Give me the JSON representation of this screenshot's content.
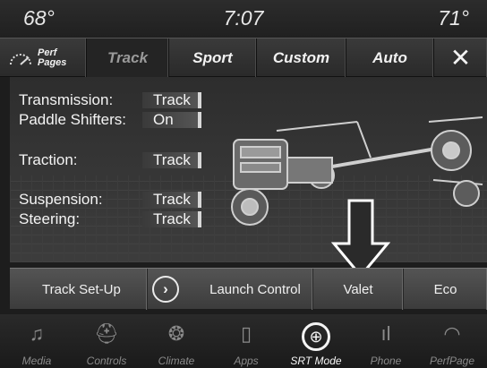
{
  "statusbar": {
    "temp_left": "68°",
    "clock": "7:07",
    "temp_right": "71°"
  },
  "tabs": {
    "perf_line1": "Perf",
    "perf_line2": "Pages",
    "track": "Track",
    "sport": "Sport",
    "custom": "Custom",
    "auto": "Auto",
    "close": "✕"
  },
  "settings": [
    {
      "label": "Transmission:",
      "value": "Track"
    },
    {
      "label": "Paddle Shifters:",
      "value": "On"
    },
    {
      "label": "Traction:",
      "value": "Track"
    },
    {
      "label": "Suspension:",
      "value": "Track"
    },
    {
      "label": "Steering:",
      "value": "Track"
    }
  ],
  "actions": {
    "setup": "Track Set-Up",
    "chevron": "›",
    "launch": "Launch Control",
    "valet": "Valet",
    "eco": "Eco"
  },
  "dock": [
    {
      "label": "Media",
      "icon": "music-note-icon",
      "glyph": "♫"
    },
    {
      "label": "Controls",
      "icon": "seat-icon",
      "glyph": "⛑"
    },
    {
      "label": "Climate",
      "icon": "climate-icon",
      "glyph": "❂"
    },
    {
      "label": "Apps",
      "icon": "apps-icon",
      "glyph": "▯"
    },
    {
      "label": "SRT Mode",
      "icon": "steering-wheel-icon",
      "glyph": "⊕"
    },
    {
      "label": "Phone",
      "icon": "phone-signal-icon",
      "glyph": "ıl"
    },
    {
      "label": "PerfPage",
      "icon": "gauge-icon",
      "glyph": "◠"
    }
  ]
}
